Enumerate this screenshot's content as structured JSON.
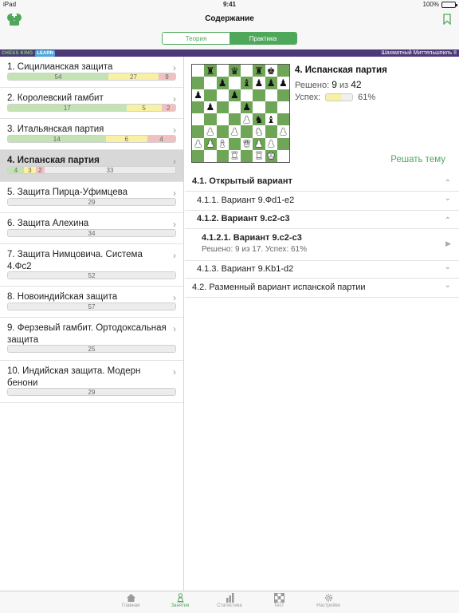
{
  "status_bar": {
    "device": "iPad",
    "time": "9:41",
    "battery": "100%",
    "battery_level": 1.0
  },
  "nav": {
    "title": "Содержание",
    "tabs": [
      "Теория",
      "Практика"
    ],
    "active_tab": "Практика"
  },
  "banner": {
    "brand": "CHESS KING",
    "brand_tag": "LEARN",
    "course": "Шахматный Миттельшпиль II"
  },
  "list": [
    {
      "title": "1. Сицилианская защита",
      "segments": [
        {
          "value": "54",
          "color": "green",
          "weight": 54
        },
        {
          "value": "27",
          "color": "yellow",
          "weight": 27
        },
        {
          "value": "9",
          "color": "red",
          "weight": 9
        }
      ]
    },
    {
      "title": "2. Королевский гамбит",
      "segments": [
        {
          "value": "17",
          "color": "green",
          "weight": 17
        },
        {
          "value": "5",
          "color": "yellow",
          "weight": 5
        },
        {
          "value": "2",
          "color": "red",
          "weight": 2
        }
      ]
    },
    {
      "title": "3. Итальянская партия",
      "segments": [
        {
          "value": "14",
          "color": "green",
          "weight": 14
        },
        {
          "value": "6",
          "color": "yellow",
          "weight": 6
        },
        {
          "value": "4",
          "color": "red",
          "weight": 4
        }
      ]
    },
    {
      "title": "4. Испанская партия",
      "selected": true,
      "segments": [
        {
          "value": "4",
          "color": "green",
          "weight": 4
        },
        {
          "value": "3",
          "color": "yellow",
          "weight": 3
        },
        {
          "value": "2",
          "color": "red",
          "weight": 2
        },
        {
          "value": "33",
          "color": "gray",
          "weight": 33
        }
      ]
    },
    {
      "title": "5. Защита Пирца-Уфимцева",
      "segments": [
        {
          "value": "29",
          "color": "gray",
          "weight": 29
        }
      ]
    },
    {
      "title": "6. Защита Алехина",
      "segments": [
        {
          "value": "34",
          "color": "gray",
          "weight": 34
        }
      ]
    },
    {
      "title": "7. Защита Нимцовича. Система 4.Фc2",
      "segments": [
        {
          "value": "52",
          "color": "gray",
          "weight": 52
        }
      ]
    },
    {
      "title": "8. Новоиндийская защита",
      "segments": [
        {
          "value": "57",
          "color": "gray",
          "weight": 57
        }
      ]
    },
    {
      "title": "9. Ферзевый гамбит. Ортодоксальная защита",
      "segments": [
        {
          "value": "25",
          "color": "gray",
          "weight": 25
        }
      ]
    },
    {
      "title": "10. Индийская защита. Модерн бенони",
      "segments": [
        {
          "value": "29",
          "color": "gray",
          "weight": 29
        }
      ]
    }
  ],
  "detail": {
    "title": "4. Испанская партия",
    "solved_label": "Решено:",
    "solved": "9",
    "of_label": "из",
    "total": "42",
    "success_label": "Успех:",
    "success": "61%",
    "success_fraction": 0.61,
    "solve_button": "Решать тему",
    "board": [
      [
        "",
        "bR",
        "",
        "bQ",
        "",
        "bR",
        "bK",
        ""
      ],
      [
        "",
        "",
        "bP",
        "",
        "bB",
        "bP",
        "bP",
        "bP"
      ],
      [
        "bP",
        "",
        "",
        "bP",
        "",
        "",
        "",
        ""
      ],
      [
        "",
        "bP",
        "",
        "",
        "bP",
        "",
        "",
        ""
      ],
      [
        "",
        "",
        "",
        "",
        "wP",
        "bN",
        "bB",
        ""
      ],
      [
        "",
        "wP",
        "",
        "wP",
        "",
        "wN",
        "",
        "wP"
      ],
      [
        "wP",
        "wP",
        "wB",
        "",
        "wQ",
        "wP",
        "wP",
        ""
      ],
      [
        "",
        "",
        "",
        "wR",
        "",
        "wR",
        "wK",
        ""
      ]
    ],
    "tree": [
      {
        "label": "4.1. Открытый вариант",
        "bold": true,
        "chevron": "up"
      },
      {
        "label": "4.1.1. Вариант 9.Фd1-e2",
        "bold": false,
        "chevron": "down"
      },
      {
        "label": "4.1.2. Вариант 9.c2-c3",
        "bold": true,
        "chevron": "up"
      },
      {
        "label": "4.1.2.1. Вариант 9.c2-c3",
        "bold": true,
        "sub": "Решено: 9 из 17. Успех: 61%",
        "chevron": "play"
      },
      {
        "label": "4.1.3. Вариант 9.Kb1-d2",
        "bold": false,
        "chevron": "down"
      },
      {
        "label": "4.2. Разменный вариант испанской партии",
        "bold": false,
        "chevron": "down"
      }
    ]
  },
  "tabbar": [
    {
      "label": "Главная",
      "icon": "home-icon",
      "active": false
    },
    {
      "label": "Занятия",
      "icon": "pawn-icon",
      "active": true
    },
    {
      "label": "Статистика",
      "icon": "bar-chart-icon",
      "active": false
    },
    {
      "label": "Тест",
      "icon": "chessboard-icon",
      "active": false
    },
    {
      "label": "Настройки",
      "icon": "gear-icon",
      "active": false
    }
  ],
  "colors": {
    "accent": "#4fa85a",
    "banner": "#4b3a77",
    "progress_green": "#c3e3b5",
    "progress_yellow": "#f8f0a4",
    "progress_red": "#f1c0c0"
  }
}
